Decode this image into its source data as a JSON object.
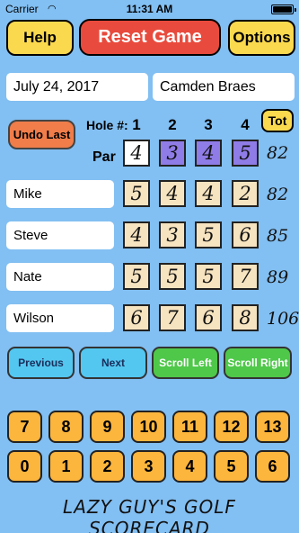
{
  "status_bar": {
    "carrier": "Carrier",
    "wifi_icon": "wifi-icon",
    "time": "11:31 AM",
    "battery_icon": "battery-icon"
  },
  "header": {
    "help_label": "Help",
    "reset_label": "Reset Game",
    "options_label": "Options"
  },
  "info": {
    "date": "July 24, 2017",
    "course": "Camden Braes"
  },
  "scorecard": {
    "undo_label": "Undo Last",
    "hole_label": "Hole #:",
    "holes": [
      "1",
      "2",
      "3",
      "4"
    ],
    "par_label": "Par",
    "par_values": [
      "4",
      "3",
      "4",
      "5"
    ],
    "par_total": "82",
    "tot_label": "Tot",
    "players": [
      {
        "name": "Mike",
        "scores": [
          "5",
          "4",
          "4",
          "2"
        ],
        "total": "82"
      },
      {
        "name": "Steve",
        "scores": [
          "4",
          "3",
          "5",
          "6"
        ],
        "total": "85"
      },
      {
        "name": "Nate",
        "scores": [
          "5",
          "5",
          "5",
          "7"
        ],
        "total": "89"
      },
      {
        "name": "Wilson",
        "scores": [
          "6",
          "7",
          "6",
          "8"
        ],
        "total": "106"
      }
    ]
  },
  "nav": {
    "previous": "Previous",
    "next": "Next",
    "scroll_left": "Scroll Left",
    "scroll_right": "Scroll Right"
  },
  "keypad": {
    "row1": [
      "7",
      "8",
      "9",
      "10",
      "11",
      "12",
      "13"
    ],
    "row2": [
      "0",
      "1",
      "2",
      "3",
      "4",
      "5",
      "6"
    ]
  },
  "footer": "LAZY GUY'S GOLF SCORECARD",
  "colors": {
    "background": "#82bff2",
    "reset_red": "#e84b3d",
    "button_yellow": "#fbd94f",
    "keypad_orange": "#fcb53d",
    "par_purple": "#8f7ce6",
    "score_tan": "#f6e3bf"
  }
}
